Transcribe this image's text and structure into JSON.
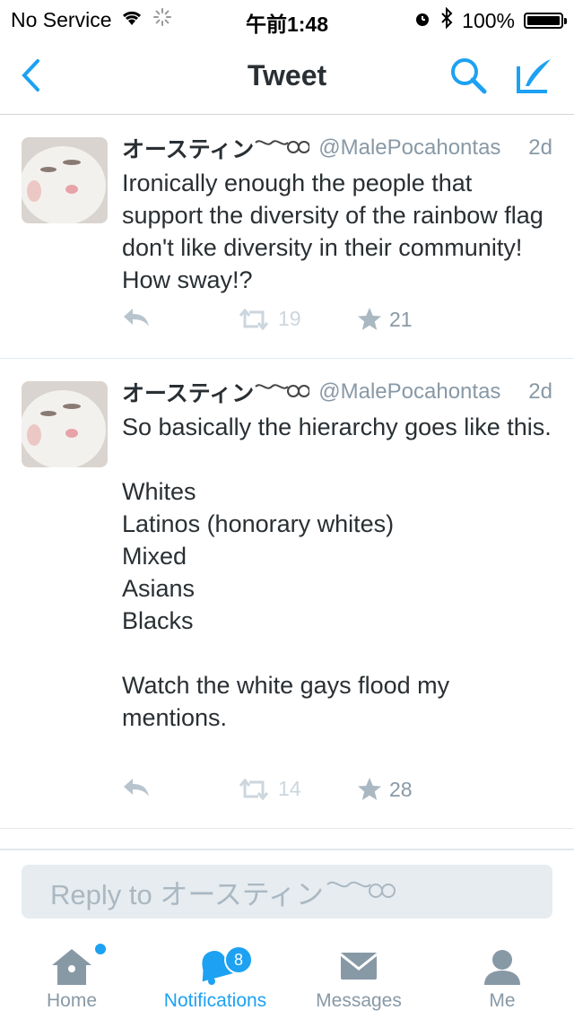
{
  "status_bar": {
    "carrier": "No Service",
    "time": "午前1:48",
    "battery": "100%"
  },
  "nav": {
    "title": "Tweet"
  },
  "tweets": [
    {
      "display_name": "オースティン",
      "handle": "@MalePocahontas",
      "time": "2d",
      "text": "Ironically enough the people that support the diversity of the rainbow flag don't like diversity in their community! How sway!?",
      "retweets": "19",
      "likes": "21"
    },
    {
      "display_name": "オースティン",
      "handle": "@MalePocahontas",
      "time": "2d",
      "text": "So basically the hierarchy goes like this.\n\nWhites\nLatinos (honorary whites)\nMixed\nAsians\nBlacks\n\nWatch the white gays flood my mentions.",
      "retweets": "14",
      "likes": "28"
    }
  ],
  "reply": {
    "placeholder": "Reply to オースティン"
  },
  "tabs": [
    {
      "label": "Home"
    },
    {
      "label": "Notifications",
      "badge": "8"
    },
    {
      "label": "Messages"
    },
    {
      "label": "Me"
    }
  ],
  "colors": {
    "accent": "#1da1f2",
    "muted": "#8899a6"
  }
}
